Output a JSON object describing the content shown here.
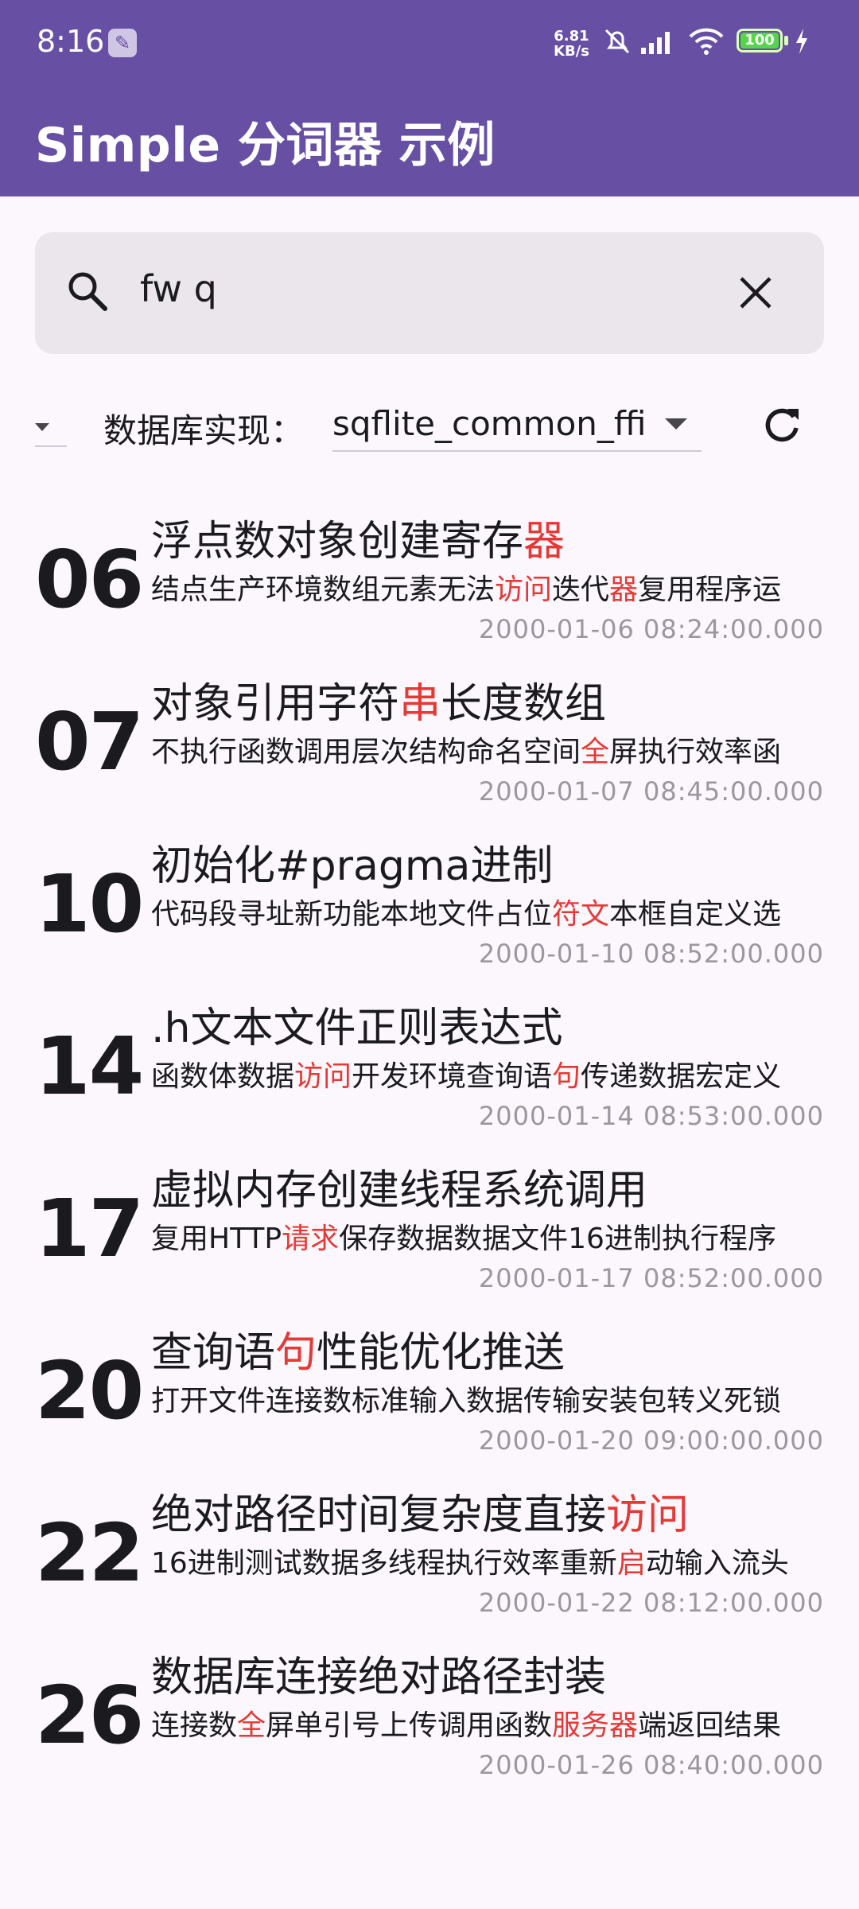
{
  "status_bar": {
    "time": "8:16",
    "net_speed_top": "6.81",
    "net_speed_bottom": "KB/s",
    "battery": "100",
    "icons": [
      "wrench-icon",
      "mute-bell-icon",
      "signal-icon",
      "wifi-icon",
      "battery-icon",
      "charging-bolt-icon"
    ]
  },
  "app_bar": {
    "title": "Simple 分词器 示例"
  },
  "search": {
    "value": "fw q",
    "icons": [
      "search-icon",
      "clear-icon"
    ]
  },
  "controls": {
    "db_label": "数据库实现：",
    "db_value": "sqflite_common_ffi",
    "icons": [
      "chevron-down-icon",
      "refresh-icon"
    ]
  },
  "colors": {
    "primary": "#6750A4",
    "highlight": "#E53935",
    "timestamp": "#9A97A0",
    "background": "#FBF7FC",
    "search_bg": "#EAE6EC"
  },
  "items": [
    {
      "day": "06",
      "title": [
        "浮点数对象创建寄存",
        "器",
        ""
      ],
      "desc": [
        "结点生产环境数组元素无法",
        "访问",
        "迭代",
        "器",
        "复用程序运"
      ],
      "timestamp": "2000-01-06 08:24:00.000"
    },
    {
      "day": "07",
      "title": [
        "对象引用字符",
        "串",
        "长度数组"
      ],
      "desc": [
        "不执行函数调用层次结构命名空间",
        "全",
        "屏执行效率函"
      ],
      "timestamp": "2000-01-07 08:45:00.000"
    },
    {
      "day": "10",
      "title": [
        "初始化#pragma进制",
        "",
        ""
      ],
      "desc": [
        "代码段寻址新功能本地文件占位",
        "符文",
        "本框自定义选"
      ],
      "timestamp": "2000-01-10 08:52:00.000"
    },
    {
      "day": "14",
      "title": [
        ".h文本文件正则表达式",
        "",
        ""
      ],
      "desc": [
        "函数体数据",
        "访问",
        "开发环境查询语",
        "句",
        "传递数据宏定义"
      ],
      "timestamp": "2000-01-14 08:53:00.000"
    },
    {
      "day": "17",
      "title": [
        "虚拟内存创建线程系统调用",
        "",
        ""
      ],
      "desc": [
        "复用HTTP",
        "请求",
        "保存数据数据文件16进制执行程序"
      ],
      "timestamp": "2000-01-17 08:52:00.000"
    },
    {
      "day": "20",
      "title": [
        "查询语",
        "句",
        "性能优化推送"
      ],
      "desc": [
        "打开文件连接数标准输入数据传输安装包转义死锁",
        "",
        ""
      ],
      "timestamp": "2000-01-20 09:00:00.000"
    },
    {
      "day": "22",
      "title": [
        "绝对路径时间复杂度直接",
        "访问",
        ""
      ],
      "desc": [
        "16进制测试数据多线程执行效率重新",
        "启",
        "动输入流头"
      ],
      "timestamp": "2000-01-22 08:12:00.000"
    },
    {
      "day": "26",
      "title": [
        "数据库连接绝对路径封装",
        "",
        ""
      ],
      "desc": [
        "连接数",
        "全",
        "屏单引号上传调用函数",
        "服务器",
        "端返回结果"
      ],
      "timestamp": "2000-01-26 08:40:00.000"
    }
  ]
}
